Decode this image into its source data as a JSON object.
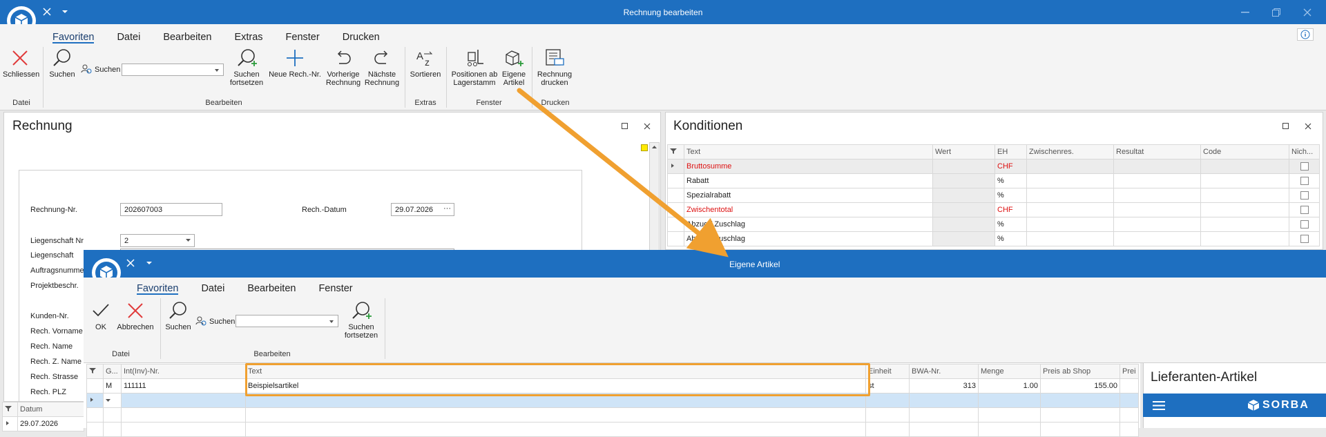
{
  "main": {
    "title": "Rechnung bearbeiten",
    "menu": [
      "Favoriten",
      "Datei",
      "Bearbeiten",
      "Extras",
      "Fenster",
      "Drucken"
    ],
    "ribbon": {
      "schliessen": "Schliessen",
      "suchen": "Suchen",
      "suchen_label": "Suchen",
      "suchen_fortsetzen": [
        "Suchen",
        "fortsetzen"
      ],
      "neue_rech": "Neue Rech.-Nr.",
      "vorherige": [
        "Vorherige",
        "Rechnung"
      ],
      "naechste": [
        "Nächste",
        "Rechnung"
      ],
      "sortieren": "Sortieren",
      "positionen": [
        "Positionen ab",
        "Lagerstamm"
      ],
      "eigene": [
        "Eigene",
        "Artikel"
      ],
      "drucken": [
        "Rechnung",
        "drucken"
      ],
      "groups": [
        "Datei",
        "Bearbeiten",
        "Extras",
        "Fenster",
        "Drucken"
      ]
    },
    "rechnung": {
      "title": "Rechnung",
      "labels": [
        "Rechnung-Nr.",
        "Liegenschaft Nr",
        "Liegenschaft",
        "Auftragsnumme",
        "Projektbeschr.",
        "Kunden-Nr.",
        "Rech. Vorname",
        "Rech. Name",
        "Rech. Z. Name",
        "Rech. Strasse",
        "Rech. PLZ"
      ],
      "rechnung_nr": "202607003",
      "datum_label": "Rech.-Datum",
      "datum": "29.07.2026",
      "liegenschaft_nr": "2"
    },
    "bottom_grid": {
      "header": "Datum",
      "value": "29.07.2026"
    },
    "konditionen": {
      "title": "Konditionen",
      "columns": [
        "Text",
        "Wert",
        "EH",
        "Zwischenres.",
        "Resultat",
        "Code",
        "Nich..."
      ],
      "rows": [
        {
          "text": "Bruttosumme",
          "eh": "CHF",
          "red": true
        },
        {
          "text": "Rabatt",
          "eh": "%",
          "red": false
        },
        {
          "text": "Spezialrabatt",
          "eh": "%",
          "red": false
        },
        {
          "text": "Zwischentotal",
          "eh": "CHF",
          "red": true
        },
        {
          "text": "Abzug / Zuschlag",
          "eh": "%",
          "red": false
        },
        {
          "text": "Abzug / Zuschlag",
          "eh": "%",
          "red": false
        }
      ]
    }
  },
  "dialog": {
    "title": "Eigene Artikel",
    "menu": [
      "Favoriten",
      "Datei",
      "Bearbeiten",
      "Fenster"
    ],
    "ribbon": {
      "ok": "OK",
      "abbrechen": "Abbrechen",
      "suchen": "Suchen",
      "suchen_label": "Suchen",
      "suchen_fortsetzen": [
        "Suchen",
        "fortsetzen"
      ],
      "groups": [
        "Datei",
        "Bearbeiten"
      ]
    },
    "grid": {
      "columns": [
        "G...",
        "Int(Inv)-Nr.",
        "Text",
        "Einheit",
        "BWA-Nr.",
        "Menge",
        "Preis ab Shop",
        "Prei"
      ],
      "row": {
        "g": "M",
        "nr": "111111",
        "text": "Beispielsartikel",
        "einheit": "st",
        "bwa": "313",
        "menge": "1.00",
        "preis": "155.00"
      }
    },
    "lieferanten": {
      "title": "Lieferanten-Artikel",
      "brand": "SORBA"
    }
  },
  "colors": {
    "accent": "#1e6fc0",
    "highlight": "#f0a030",
    "red": "#d11111"
  }
}
